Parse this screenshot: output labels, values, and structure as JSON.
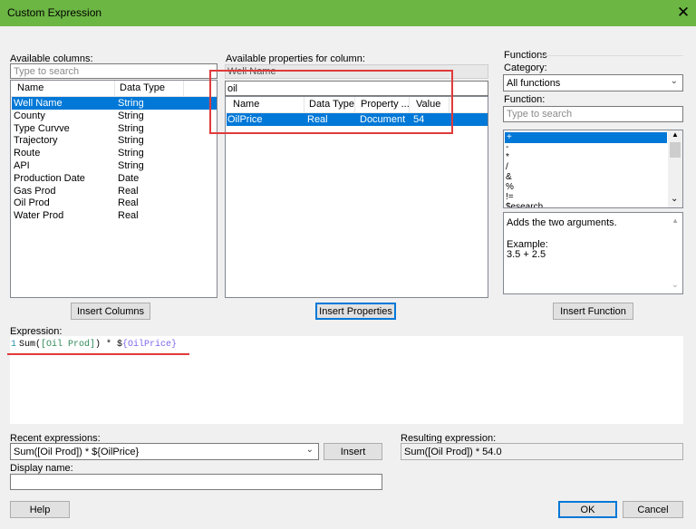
{
  "window": {
    "title": "Custom Expression",
    "close_icon": "close-icon"
  },
  "available_columns": {
    "label": "Available columns:",
    "search_placeholder": "Type to search",
    "headers": [
      "Name",
      "Data Type"
    ],
    "rows": [
      {
        "name": "Well Name",
        "type": "String",
        "selected": true
      },
      {
        "name": "County",
        "type": "String"
      },
      {
        "name": "Type Curvve",
        "type": "String"
      },
      {
        "name": "Trajectory",
        "type": "String"
      },
      {
        "name": "Route",
        "type": "String"
      },
      {
        "name": "API",
        "type": "String"
      },
      {
        "name": "Production Date",
        "type": "Date"
      },
      {
        "name": "Gas Prod",
        "type": "Real"
      },
      {
        "name": "Oil Prod",
        "type": "Real"
      },
      {
        "name": "Water Prod",
        "type": "Real"
      }
    ],
    "insert_button": "Insert Columns"
  },
  "available_properties": {
    "label": "Available properties for column:",
    "column_value": "Well Name",
    "search_value": "oil",
    "headers": [
      "Name",
      "Data Type",
      "Property ...",
      "Value"
    ],
    "rows": [
      {
        "name": "OilPrice",
        "type": "Real",
        "property": "Document",
        "value": "54",
        "selected": true
      }
    ],
    "insert_button": "Insert Properties"
  },
  "functions": {
    "group_label": "Functions",
    "category_label": "Category:",
    "category_value": "All functions",
    "function_label": "Function:",
    "search_placeholder": "Type to search",
    "items": [
      "+",
      "-",
      "*",
      "/",
      "&",
      "%",
      "!=",
      "$esearch"
    ],
    "description": "Adds the two arguments.",
    "example_label": "Example:",
    "example_value": "3.5 + 2.5",
    "insert_button": "Insert Function"
  },
  "expression": {
    "label": "Expression:",
    "line_number": "1",
    "code_sum": "Sum(",
    "code_col": "[Oil Prod]",
    "code_mid": ") * $",
    "code_prop": "{OilPrice}"
  },
  "recent": {
    "label": "Recent expressions:",
    "value": "Sum([Oil Prod]) * ${OilPrice}",
    "insert_button": "Insert"
  },
  "resulting": {
    "label": "Resulting expression:",
    "value": "Sum([Oil Prod]) * 54.0"
  },
  "display_name": {
    "label": "Display name:",
    "value": ""
  },
  "footer": {
    "help": "Help",
    "ok": "OK",
    "cancel": "Cancel"
  },
  "colors": {
    "titlebar": "#6cb644",
    "selection": "#0078d7",
    "highlight": "#e03a3a"
  }
}
